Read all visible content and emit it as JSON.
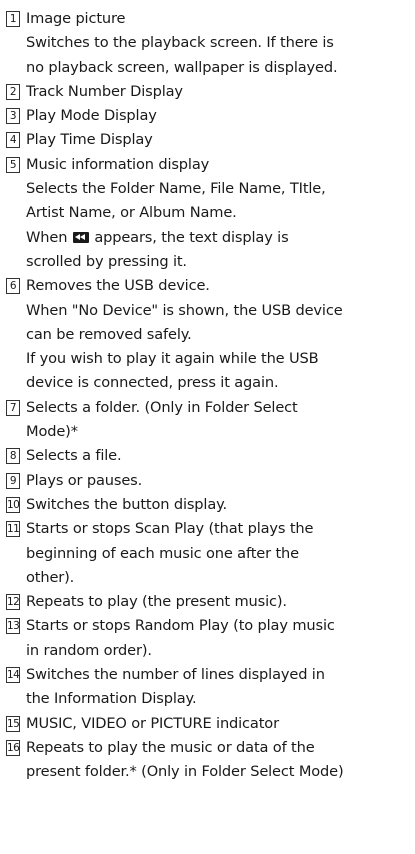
{
  "items": [
    {
      "num": "1",
      "lines": [
        "Image picture",
        "Switches to the playback screen. If there is",
        "no playback screen, wallpaper is displayed."
      ]
    },
    {
      "num": "2",
      "lines": [
        "Track Number Display"
      ]
    },
    {
      "num": "3",
      "lines": [
        "Play Mode Display"
      ]
    },
    {
      "num": "4",
      "lines": [
        "Play Time Display"
      ]
    },
    {
      "num": "5",
      "lines": [
        "Music information display",
        "Selects the Folder Name, File Name, TItle,",
        "Artist Name, or Album Name.",
        "When",
        "appears, the text display is",
        "scrolled by pressing it."
      ]
    },
    {
      "num": "6",
      "lines": [
        "Removes the USB device.",
        "When \"No Device\" is shown, the USB device",
        "can be removed safely.",
        "If you wish to play it again while the USB",
        "device is connected, press it again."
      ]
    },
    {
      "num": "7",
      "lines": [
        "Selects a folder. (Only in Folder Select",
        "Mode)*"
      ]
    },
    {
      "num": "8",
      "lines": [
        "Selects a file."
      ]
    },
    {
      "num": "9",
      "lines": [
        "Plays or pauses."
      ]
    },
    {
      "num": "10",
      "lines": [
        "Switches the button display."
      ]
    },
    {
      "num": "11",
      "lines": [
        "Starts or stops Scan Play (that plays the",
        "beginning of each music one after the",
        "other)."
      ]
    },
    {
      "num": "12",
      "lines": [
        "Repeats to play (the present music)."
      ]
    },
    {
      "num": "13",
      "lines": [
        "Starts or stops Random Play (to play music",
        "in random order)."
      ]
    },
    {
      "num": "14",
      "lines": [
        "Switches the number of lines displayed in",
        "the Information Display."
      ]
    },
    {
      "num": "15",
      "lines": [
        "MUSIC, VIDEO or PICTURE indicator"
      ]
    },
    {
      "num": "16",
      "lines": [
        "Repeats to play the music or data of the",
        "present folder.* (Only in Folder Select Mode)"
      ]
    }
  ],
  "icons": {
    "scroll": "scroll-text-icon"
  }
}
